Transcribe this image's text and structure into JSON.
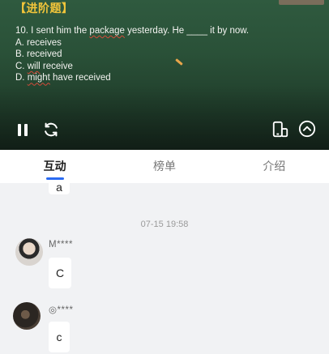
{
  "video": {
    "title": "【进阶题】",
    "question": "10. I sent him the package yesterday. He ____ it by now.",
    "options": [
      "A. receives",
      "B. received",
      "C. will receive",
      "D. might have received"
    ]
  },
  "controls": {
    "pause_icon": "pause-icon",
    "refresh_icon": "refresh-icon",
    "phone_icon": "phone-rotate-icon",
    "collapse_icon": "chevron-up-icon"
  },
  "tabs": [
    {
      "label": "互动",
      "active": true
    },
    {
      "label": "榜单",
      "active": false
    },
    {
      "label": "介绍",
      "active": false
    }
  ],
  "chat": {
    "prev_message": "a",
    "timestamp": "07-15 19:58",
    "messages": [
      {
        "user": "M****",
        "text": "C"
      },
      {
        "user": "◎****",
        "text": "c"
      }
    ]
  },
  "colors": {
    "accent": "#2a6bf2",
    "title": "#f2c53a",
    "board": "#2a5138"
  }
}
